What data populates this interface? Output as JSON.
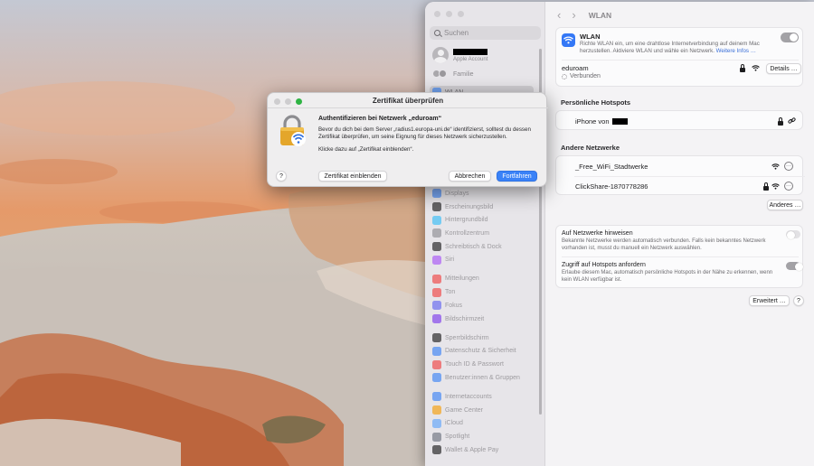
{
  "dialog": {
    "title": "Zertifikat überprüfen",
    "heading": "Authentifizieren bei Netzwerk „eduroam“",
    "body": "Bevor du dich bei dem Server „radius1.europa-uni.de“ identifizierst, solltest du dessen Zertifikat überprüfen, um seine Eignung für dieses Netzwerk sicherzustellen.",
    "hint": "Klicke dazu auf „Zertifikat einblenden“.",
    "help_label": "?",
    "show_cert_label": "Zertifikat einblenden",
    "cancel_label": "Abbrechen",
    "continue_label": "Fortfahren"
  },
  "sidebar": {
    "search_placeholder": "Suchen",
    "account_sub": "Apple Account",
    "family": "Familie",
    "selected": "WLAN",
    "items": [
      {
        "label": "Displays",
        "color": "#3b82f6"
      },
      {
        "label": "Erscheinungsbild",
        "color": "#1d1d1f"
      },
      {
        "label": "Hintergrundbild",
        "color": "#38bdf8"
      },
      {
        "label": "Kontrollzentrum",
        "color": "#8e8e93"
      },
      {
        "label": "Schreibtisch & Dock",
        "color": "#1d1d1f"
      },
      {
        "label": "Siri",
        "color": "#a855f7"
      },
      {
        "gap": true
      },
      {
        "label": "Mitteilungen",
        "color": "#ef4444"
      },
      {
        "label": "Ton",
        "color": "#ef4444"
      },
      {
        "label": "Fokus",
        "color": "#6366f1"
      },
      {
        "label": "Bildschirmzeit",
        "color": "#7c3aed"
      },
      {
        "gap": true
      },
      {
        "label": "Sperrbildschirm",
        "color": "#1d1d1f"
      },
      {
        "label": "Datenschutz & Sicherheit",
        "color": "#3b82f6"
      },
      {
        "label": "Touch ID & Passwort",
        "color": "#ef4444"
      },
      {
        "label": "Benutzer:innen & Gruppen",
        "color": "#3b82f6"
      },
      {
        "gap": true
      },
      {
        "label": "Internetaccounts",
        "color": "#3b82f6"
      },
      {
        "label": "Game Center",
        "color": "#f59e0b"
      },
      {
        "label": "iCloud",
        "color": "#60a5fa"
      },
      {
        "label": "Spotlight",
        "color": "#6b7280"
      },
      {
        "label": "Wallet & Apple Pay",
        "color": "#1d1d1f"
      }
    ]
  },
  "header": {
    "title": "WLAN"
  },
  "wlan": {
    "title": "WLAN",
    "desc": "Richte WLAN ein, um eine drahtlose Internetverbindung auf deinem Mac herzustellen. Aktiviere WLAN und wähle ein Netzwerk.",
    "more_info": "Weitere Infos …",
    "current_network": "eduroam",
    "status": "Verbunden",
    "details_label": "Details …"
  },
  "hotspots": {
    "title": "Persönliche Hotspots",
    "device_prefix": "iPhone von"
  },
  "other_networks": {
    "title": "Andere Netzwerke",
    "networks": [
      {
        "name": "_Free_WiFi_Stadtwerke",
        "locked": false
      },
      {
        "name": "ClickShare-1870778286",
        "locked": true
      }
    ],
    "other_label": "Anderes …"
  },
  "options": {
    "ask_title": "Auf Netzwerke hinweisen",
    "ask_desc": "Bekannte Netzwerke werden automatisch verbunden. Falls kein bekanntes Netzwerk vorhanden ist, musst du manuell ein Netzwerk auswählen.",
    "hotspot_title": "Zugriff auf Hotspots anfordern",
    "hotspot_desc": "Erlaube diesem Mac, automatisch persönliche Hotspots in der Nähe zu erkennen, wenn kein WLAN verfügbar ist."
  },
  "footer": {
    "advanced_label": "Erweitert …",
    "help_label": "?"
  }
}
